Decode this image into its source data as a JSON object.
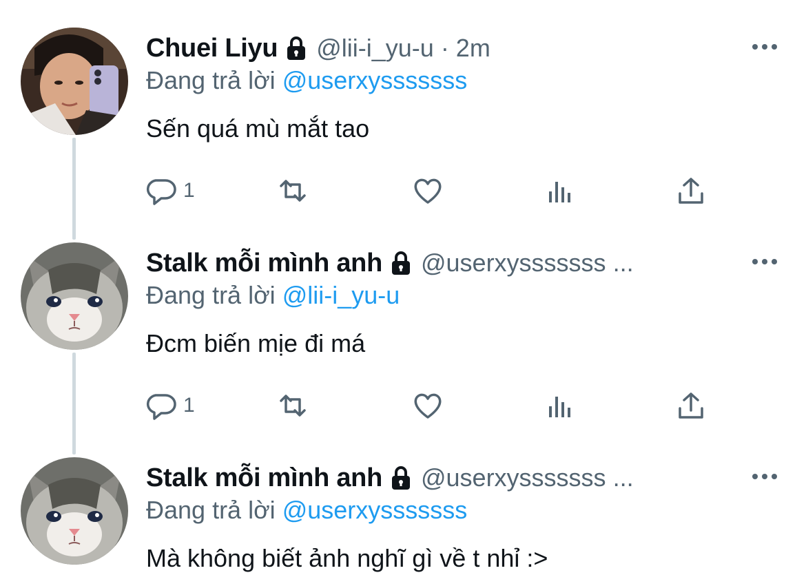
{
  "tweets": [
    {
      "name": "Chuei Liyu",
      "handle": "@lii-i_yu-u · 2m",
      "reply_prefix": "Đang trả lời",
      "reply_to": "@userxysssssss",
      "text": "Sến quá mù mắt tao",
      "reply_count": "1",
      "avatar": "person-selfie-avatar"
    },
    {
      "name": "Stalk mỗi mình anh",
      "handle": "@userxysssssss ...",
      "reply_prefix": "Đang trả lời",
      "reply_to": "@lii-i_yu-u",
      "text": "Đcm biến mịe đi má",
      "reply_count": "1",
      "avatar": "crying-cat-avatar"
    },
    {
      "name": "Stalk mỗi mình anh",
      "handle": "@userxysssssss ...",
      "reply_prefix": "Đang trả lời",
      "reply_to": "@userxysssssss",
      "text": "Mà không biết ảnh nghĩ gì về t nhỉ :>",
      "avatar": "crying-cat-avatar"
    }
  ],
  "colors": {
    "text": "#0f1419",
    "secondary": "#536471",
    "link": "#1d9bf0",
    "thread_line": "#cfd9de"
  },
  "icons": [
    "lock-icon",
    "more-icon",
    "reply-icon",
    "retweet-icon",
    "like-icon",
    "analytics-icon",
    "share-icon"
  ]
}
